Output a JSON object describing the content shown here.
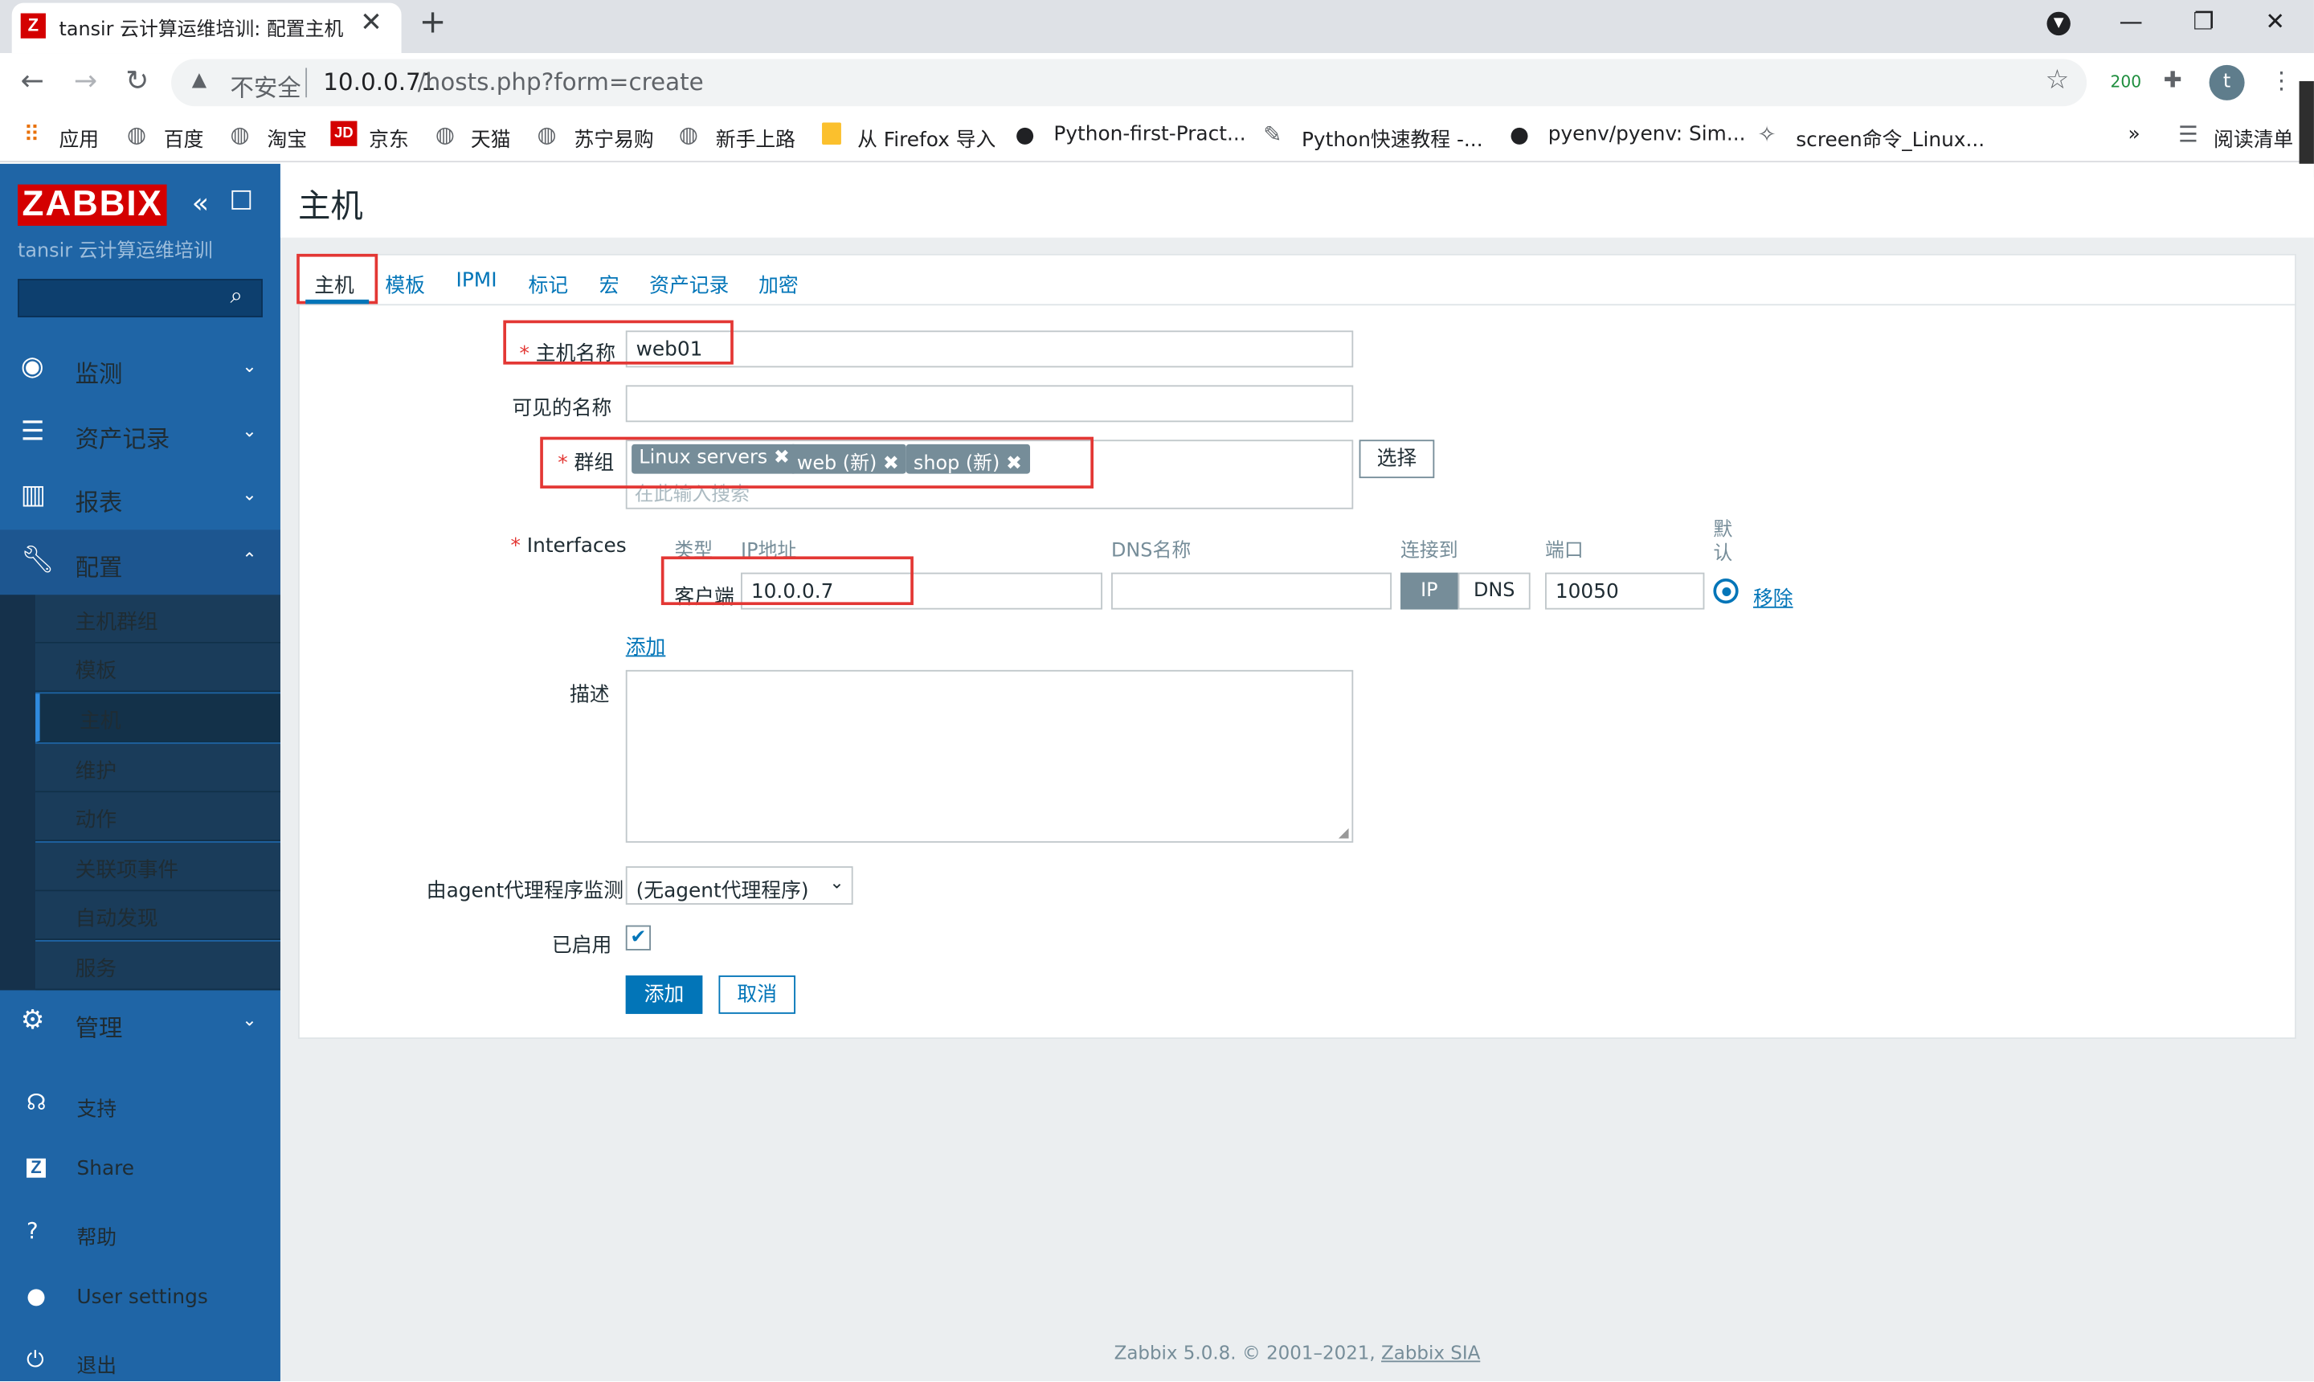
{
  "browser": {
    "tab_title": "tansir 云计算运维培训: 配置主机",
    "favicon_letter": "Z",
    "insecure_label": "不安全",
    "url_host": "10.0.0.71",
    "url_path": "/hosts.php?form=create",
    "badge_count": "200",
    "profile_initial": "t",
    "bookmarks": [
      "应用",
      "百度",
      "淘宝",
      "京东",
      "天猫",
      "苏宁易购",
      "新手上路",
      "从 Firefox 导入",
      "Python-first-Pract...",
      "Python快速教程 -...",
      "pyenv/pyenv: Sim...",
      "screen命令_Linux..."
    ],
    "bookmarks_more": "»",
    "reading_list": "阅读清单",
    "jd_badge": "JD"
  },
  "sidebar": {
    "logo": "ZABBIX",
    "subtitle": "tansir 云计算运维培训",
    "menu": [
      {
        "label": "监测",
        "icon": "eye-icon"
      },
      {
        "label": "资产记录",
        "icon": "list-icon"
      },
      {
        "label": "报表",
        "icon": "chart-icon"
      },
      {
        "label": "配置",
        "icon": "wrench-icon"
      }
    ],
    "config_items": [
      "主机群组",
      "模板",
      "主机",
      "维护",
      "动作",
      "关联项事件",
      "自动发现",
      "服务"
    ],
    "admin": "管理",
    "bottom": [
      "支持",
      "Share",
      "帮助",
      "User settings",
      "退出"
    ]
  },
  "page": {
    "title": "主机",
    "tabs": [
      "主机",
      "模板",
      "IPMI",
      "标记",
      "宏",
      "资产记录",
      "加密"
    ]
  },
  "form": {
    "host_name_label": "主机名称",
    "host_name_value": "web01",
    "visible_name_label": "可见的名称",
    "visible_name_value": "",
    "groups_label": "群组",
    "groups": [
      "Linux servers",
      "web (新)",
      "shop (新)"
    ],
    "groups_placeholder": "在此输入搜索",
    "select_button": "选择",
    "interfaces_label": "Interfaces",
    "col_type": "类型",
    "col_ip": "IP地址",
    "col_dns": "DNS名称",
    "col_connect": "连接到",
    "col_port": "端口",
    "col_default": "默认",
    "iface_type": "客户端",
    "iface_ip": "10.0.0.7",
    "iface_dns": "",
    "connect_ip": "IP",
    "connect_dns": "DNS",
    "iface_port": "10050",
    "remove_link": "移除",
    "add_link": "添加",
    "description_label": "描述",
    "proxy_label": "由agent代理程序监测",
    "proxy_value": "(无agent代理程序)",
    "enabled_label": "已启用",
    "add_button": "添加",
    "cancel_button": "取消"
  },
  "footer": {
    "text": "Zabbix 5.0.8. © 2001–2021,",
    "link": "Zabbix SIA"
  },
  "colors": {
    "sidebar": "#1f65a6",
    "accent": "#0275b8",
    "logo": "#d40000",
    "highlight": "#e33734"
  }
}
